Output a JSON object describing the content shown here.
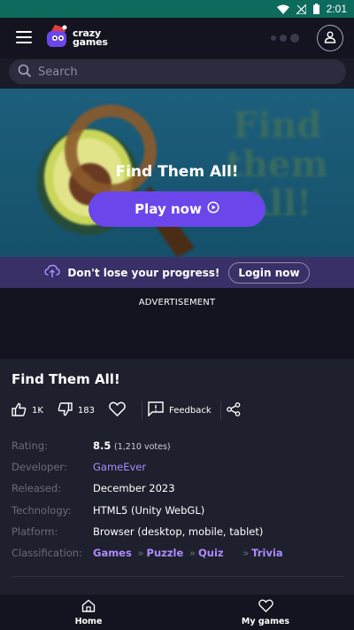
{
  "status_bar": {
    "time": "2:01",
    "icons": [
      "wifi-icon",
      "signal-icon",
      "battery-icon"
    ]
  },
  "header": {
    "logo_line1": "crazy",
    "logo_line2": "games",
    "icons": [
      "menu-icon",
      "loading-dots",
      "user-icon"
    ]
  },
  "search": {
    "placeholder": "Search"
  },
  "hero": {
    "bg_line1": "Find",
    "bg_line2": "them",
    "bg_line3": "All!",
    "title": "Find Them All!",
    "play_label": "Play now"
  },
  "progress_banner": {
    "text": "Don't lose your progress!",
    "login_label": "Login now"
  },
  "ad": {
    "label": "ADVERTISEMENT"
  },
  "game": {
    "title": "Find Them All!",
    "likes": "1K",
    "dislikes": "183",
    "feedback_label": "Feedback",
    "info": {
      "rating_label": "Rating:",
      "rating_value": "8.5",
      "rating_votes": "(1,210 votes)",
      "developer_label": "Developer:",
      "developer_value": "GameEver",
      "released_label": "Released:",
      "released_value": "December 2023",
      "technology_label": "Technology:",
      "technology_value": "HTML5 (Unity WebGL)",
      "platform_label": "Platform:",
      "platform_value": "Browser (desktop, mobile, tablet)",
      "classification_label": "Classification:",
      "classification_tags": [
        "Games",
        "Puzzle",
        "Quiz",
        "Trivia"
      ],
      "tag_separator": "»"
    }
  },
  "bottom_nav": {
    "home_label": "Home",
    "mygames_label": "My games"
  },
  "colors": {
    "status_bar": "#0d6b5e",
    "accent": "#6b46ea",
    "tag_text": "#a98bff",
    "background": "#1a1b28"
  }
}
